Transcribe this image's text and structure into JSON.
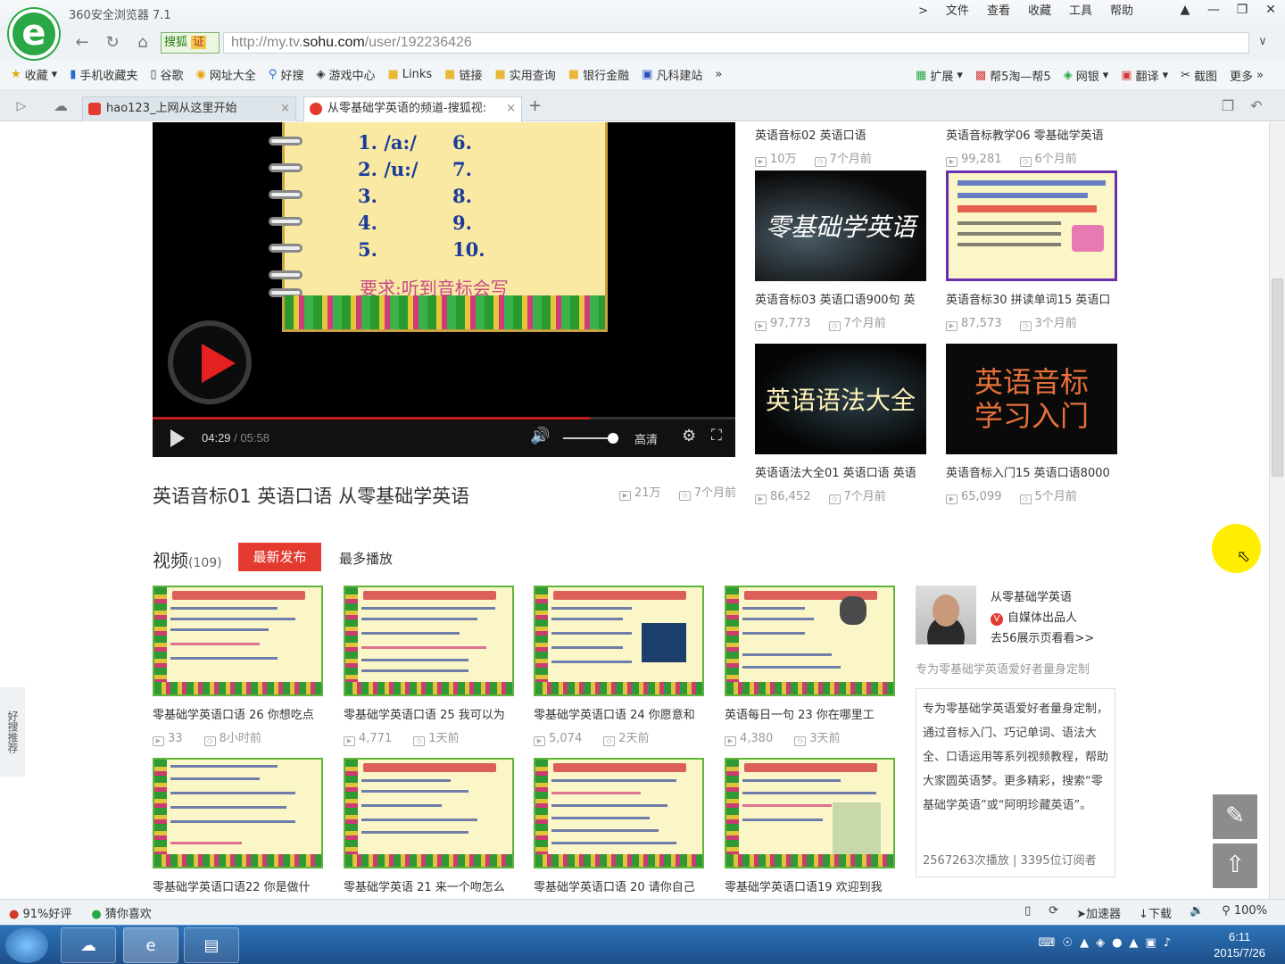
{
  "browser": {
    "title": "360安全浏览器 7.1",
    "menu": [
      "文件",
      "查看",
      "收藏",
      "工具",
      "帮助"
    ],
    "search_engine": "搜狐",
    "search_engine_badge": "证",
    "url_prefix": "http://my.tv.",
    "url_domain": "sohu.com",
    "url_path": "/user/192236426",
    "favorites_left": [
      "收藏",
      "手机收藏夹",
      "谷歌",
      "网址大全",
      "好搜",
      "游戏中心",
      "Links",
      "链接",
      "实用查询",
      "银行金融",
      "凡科建站"
    ],
    "favorites_right": [
      "扩展",
      "帮5淘—帮5",
      "网银",
      "翻译",
      "截图",
      "更多"
    ],
    "tabs": [
      {
        "label": "hao123_上网从这里开始",
        "active": false
      },
      {
        "label": "从零基础学英语的频道-搜狐视:",
        "active": true
      }
    ]
  },
  "player": {
    "slide_numbers_left": [
      "1. /a:/",
      "2. /u:/",
      "3.",
      "4.",
      "5."
    ],
    "slide_numbers_right": [
      "6.",
      "7.",
      "8.",
      "9.",
      "10."
    ],
    "slide_requirement": "要求:听到音标会写",
    "time_current": "04:29",
    "time_sep": " / ",
    "time_total": "05:58",
    "progress": 0.75,
    "volume": 0.9,
    "quality_label": "高清"
  },
  "main_video": {
    "title": "英语音标01 英语口语 从零基础学英语",
    "views": "21万",
    "age": "7个月前"
  },
  "side_videos_top": [
    {
      "title": "英语音标02 英语口语",
      "views": "10万",
      "age": "7个月前"
    },
    {
      "title": "英语音标教学06 零基础学英语",
      "views": "99,281",
      "age": "6个月前"
    }
  ],
  "side_videos": [
    {
      "thumb_text": "零基础学英语",
      "title": "英语音标03 英语口语900句 英",
      "views": "97,773",
      "age": "7个月前"
    },
    {
      "thumb_text": "",
      "title": "英语音标30 拼读单词15 英语口",
      "views": "87,573",
      "age": "3个月前"
    },
    {
      "thumb_text": "英语语法大全",
      "title": "英语语法大全01 英语口语 英语",
      "views": "86,452",
      "age": "7个月前"
    },
    {
      "thumb_text": "英语音标\n学习入门",
      "title": "英语音标入门15 英语口语8000",
      "views": "65,099",
      "age": "5个月前"
    }
  ],
  "video_section": {
    "title": "视频",
    "count": "(109)",
    "tab_newest": "最新发布",
    "tab_most": "最多播放"
  },
  "videos": [
    {
      "title": "零基础学英语口语 26 你想吃点",
      "views": "33",
      "age": "8小时前"
    },
    {
      "title": "零基础学英语口语 25 我可以为",
      "views": "4,771",
      "age": "1天前"
    },
    {
      "title": "零基础学英语口语 24 你愿意和",
      "views": "5,074",
      "age": "2天前"
    },
    {
      "title": "英语每日一句 23 你在哪里工",
      "views": "4,380",
      "age": "3天前"
    },
    {
      "title": "零基础学英语口语22 你是做什",
      "views": "",
      "age": ""
    },
    {
      "title": "零基础学英语 21 来一个吻怎么",
      "views": "",
      "age": ""
    },
    {
      "title": "零基础学英语口语 20 请你自己",
      "views": "",
      "age": ""
    },
    {
      "title": "零基础学英语口语19 欢迎到我",
      "views": "",
      "age": ""
    }
  ],
  "author": {
    "name": "从零基础学英语",
    "badge": "自媒体出品人",
    "link": "去56展示页看看>>",
    "tagline": "专为零基础学英语爱好者量身定制",
    "description": "专为零基础学英语爱好者量身定制，通过音标入门、巧记单词、语法大全、口语运用等系列视频教程，帮助大家圆英语梦。更多精彩，搜索“零基础学英语”或“阿明珍藏英语”。",
    "stats": "2567263次播放 | 3395位订阅者"
  },
  "side_float": "好搜推荐",
  "statusbar": {
    "left": [
      "91%好评",
      "猜你喜欢"
    ],
    "right": [
      "加速器",
      "下载",
      "100%"
    ]
  },
  "taskbar": {
    "time": "6:11",
    "date": "2015/7/26"
  }
}
